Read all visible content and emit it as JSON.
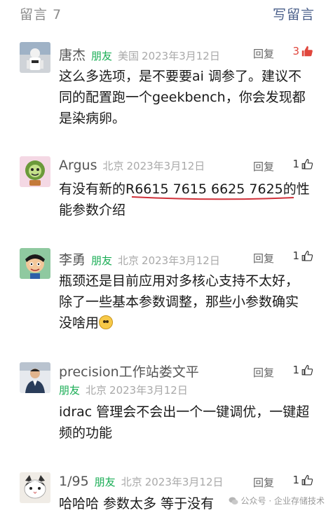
{
  "header": {
    "title": "留言 7",
    "write_label": "写留言"
  },
  "comments": [
    {
      "name": "唐杰",
      "friend": "朋友",
      "location": "美国",
      "date": "2023年3月12日",
      "reply": "回复",
      "likes": "3",
      "text": "这么多选项，是不要要ai 调参了。建议不同的配置跑一个geekbench，你会发现都是染病卵。"
    },
    {
      "name": "Argus",
      "friend": "",
      "location": "北京",
      "date": "2023年3月12日",
      "reply": "回复",
      "likes": "1",
      "text_before": "有没有新的",
      "text_underlined": "R6615  7615  6625  7625",
      "text_after": "的性能参数介绍"
    },
    {
      "name": "李勇",
      "friend": "朋友",
      "location": "北京",
      "date": "2023年3月12日",
      "reply": "回复",
      "likes": "1",
      "text": "瓶颈还是目前应用对多核心支持不太好，除了一些基本参数调整，那些小参数确实没啥用"
    },
    {
      "name": "precision工作站娄文平",
      "friend": "朋友",
      "location": "北京",
      "date": "2023年3月12日",
      "reply": "回复",
      "likes": "1",
      "text": "idrac 管理会不会出一个一键调优，一键超频的功能"
    },
    {
      "name": "1/95",
      "friend": "朋友",
      "location": "北京",
      "date": "2023年3月12日",
      "reply": "回复",
      "likes": "1",
      "text": "哈哈哈  参数太多  等于没有"
    }
  ],
  "watermark": "公众号 · 企业存储技术",
  "colors": {
    "friend": "#1aad55",
    "link": "#4a5f8a",
    "hot_like": "#e0463c",
    "underline": "#d0313a"
  },
  "icons": {
    "like": "thumb-up-icon",
    "hot_like": "thumb-up-red-icon"
  }
}
